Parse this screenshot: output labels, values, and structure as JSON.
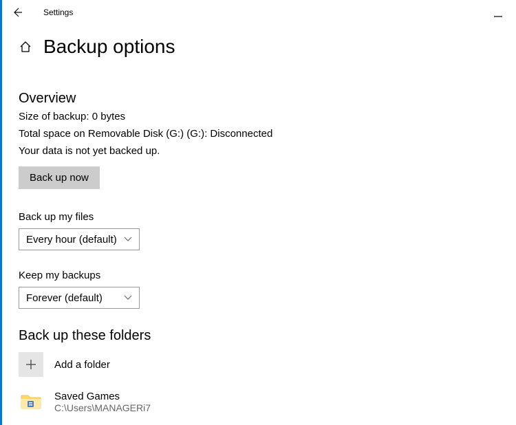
{
  "titlebar": {
    "app_name": "Settings"
  },
  "header": {
    "title": "Backup options"
  },
  "overview": {
    "heading": "Overview",
    "size_line": "Size of backup: 0 bytes",
    "space_line": "Total space on Removable Disk (G:) (G:): Disconnected",
    "status_line": "Your data is not yet backed up.",
    "backup_button": "Back up now"
  },
  "frequency": {
    "label": "Back up my files",
    "selected": "Every hour (default)"
  },
  "retention": {
    "label": "Keep my backups",
    "selected": "Forever (default)"
  },
  "folders": {
    "heading": "Back up these folders",
    "add_label": "Add a folder",
    "items": [
      {
        "name": "Saved Games",
        "path": "C:\\Users\\MANAGERi7"
      }
    ]
  }
}
